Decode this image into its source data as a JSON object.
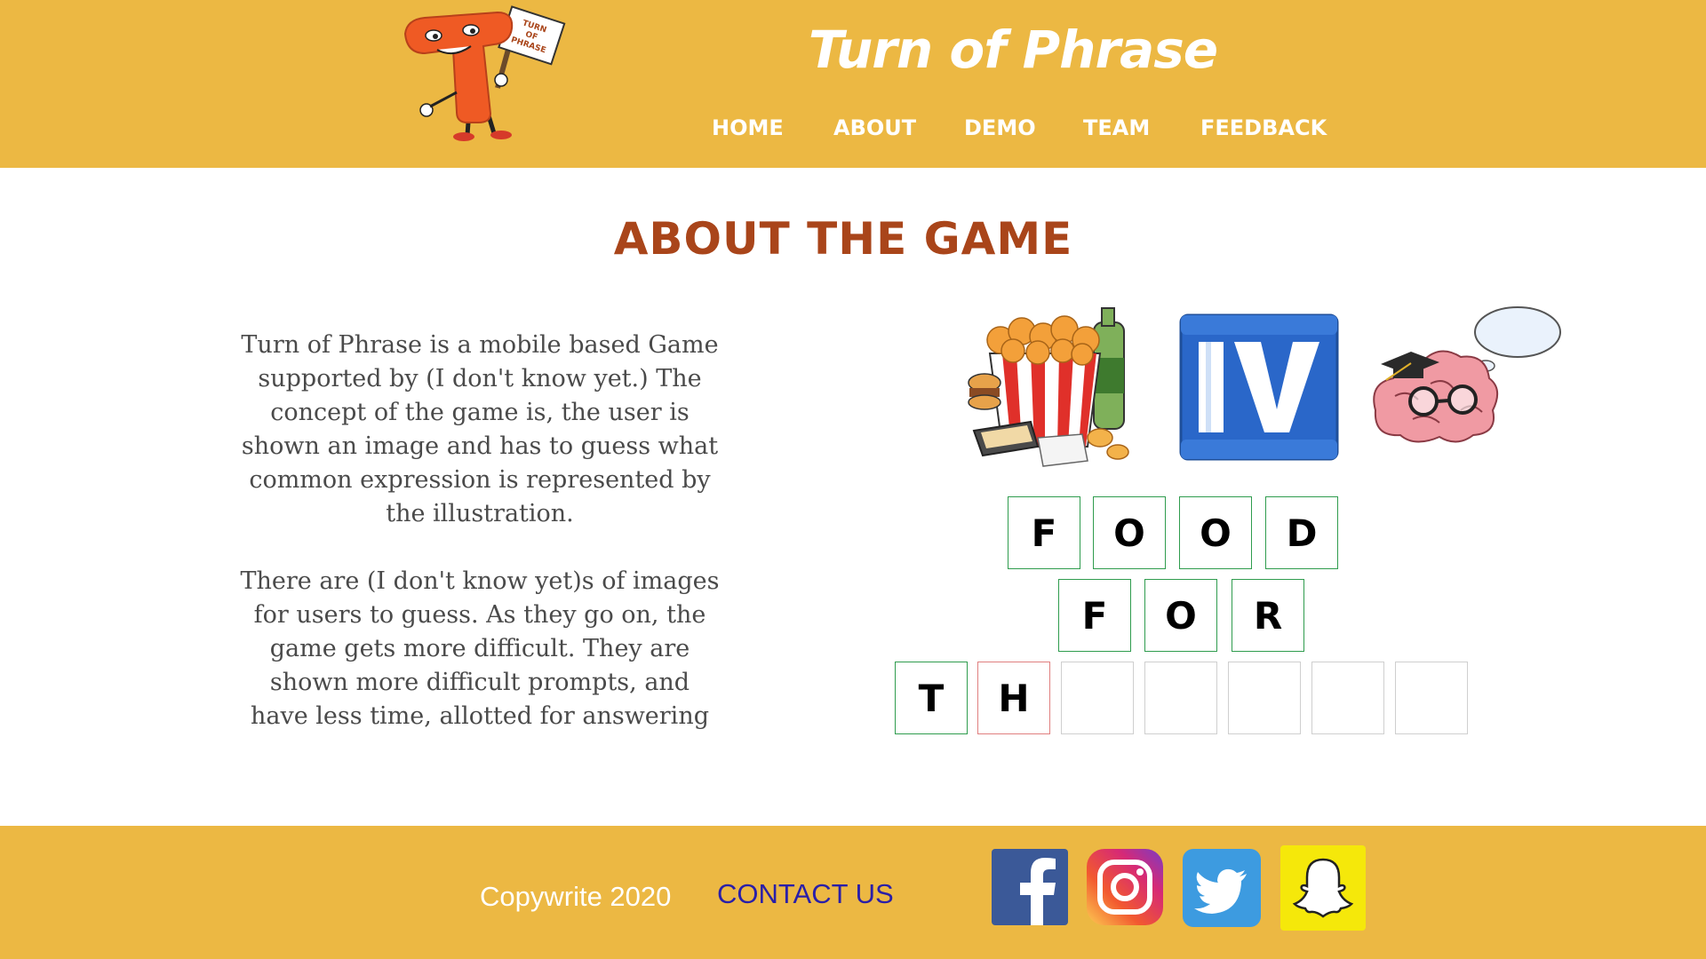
{
  "header": {
    "title": "Turn of Phrase",
    "logo_sign_text": [
      "TURN",
      "OF",
      "PHRASE"
    ],
    "nav": [
      {
        "label": "HOME"
      },
      {
        "label": "ABOUT"
      },
      {
        "label": "DEMO"
      },
      {
        "label": "TEAM"
      },
      {
        "label": "FEEDBACK"
      }
    ]
  },
  "main": {
    "heading": "ABOUT THE GAME",
    "paragraphs": [
      "Turn of Phrase is a mobile based Game supported by (I don't know yet.) The concept of the game is, the user is shown an image and has to guess what common expression is represented by the illustration.",
      "There are (I don't know yet)s of images for users to guess. As they go on, the game gets more difficult. They are shown more difficult prompts, and have less time, allotted for answering"
    ],
    "puzzle_icons": [
      "food-bucket-icon",
      "roman-numeral-four-icon",
      "thinking-brain-icon"
    ],
    "answer_rows": [
      [
        "F",
        "O",
        "O",
        "D"
      ],
      [
        "F",
        "O",
        "R"
      ],
      [
        "T",
        "H",
        "",
        "",
        "",
        "",
        ""
      ]
    ],
    "tile_states": [
      [
        "correct",
        "correct",
        "correct",
        "correct"
      ],
      [
        "correct",
        "correct",
        "correct"
      ],
      [
        "correct",
        "wrong",
        "empty",
        "empty",
        "empty",
        "empty",
        "empty"
      ]
    ]
  },
  "footer": {
    "copyright": "Copywrite 2020",
    "contact": "CONTACT US",
    "social": [
      "facebook-icon",
      "instagram-icon",
      "twitter-icon",
      "snapchat-icon"
    ]
  },
  "colors": {
    "header_bg": "#ecb843",
    "heading": "#a9451a",
    "tile_correct": "#2f9c4e",
    "tile_wrong": "#e07f7f",
    "contact_link": "#2a1fa8"
  }
}
